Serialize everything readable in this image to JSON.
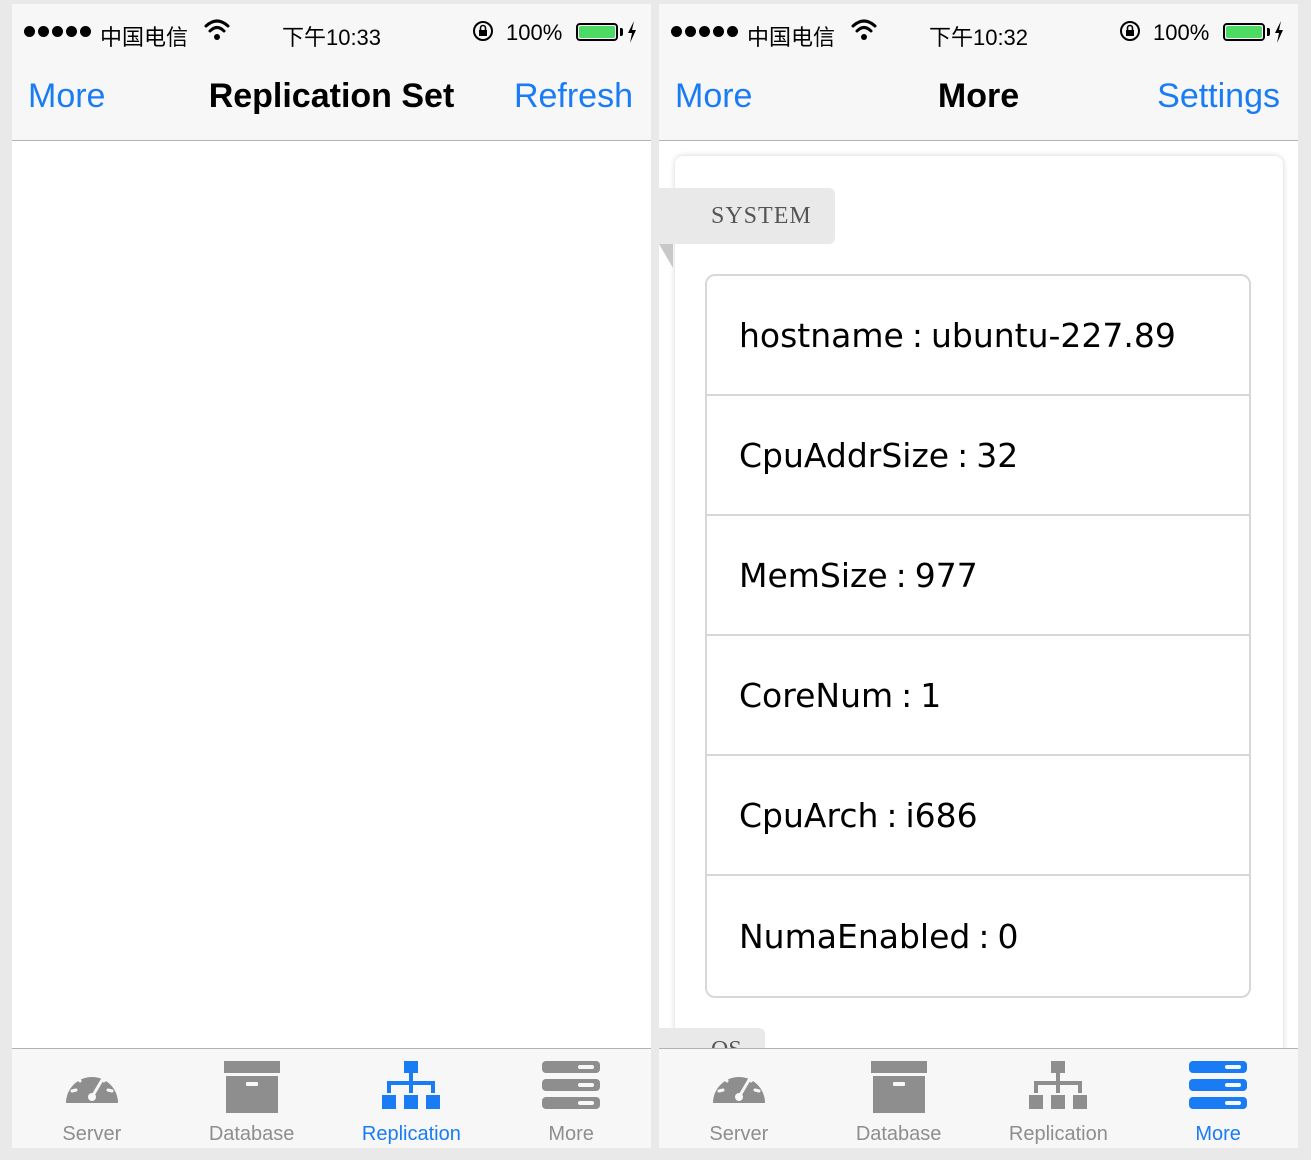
{
  "status_left": {
    "carrier": "中国电信",
    "time": "下午10:33",
    "battery": "100%"
  },
  "status_right": {
    "carrier": "中国电信",
    "time": "下午10:32",
    "battery": "100%"
  },
  "left_screen": {
    "nav": {
      "left": "More",
      "title": "Replication Set",
      "right": "Refresh"
    }
  },
  "right_screen": {
    "nav": {
      "left": "More",
      "title": "More",
      "right": "Settings"
    },
    "section_title": "SYSTEM",
    "next_section_partial": "OS",
    "rows": [
      {
        "key": "hostname",
        "value": "ubuntu-227.89"
      },
      {
        "key": "CpuAddrSize",
        "value": "32"
      },
      {
        "key": "MemSize",
        "value": "977"
      },
      {
        "key": "CoreNum",
        "value": "1"
      },
      {
        "key": "CpuArch",
        "value": "i686"
      },
      {
        "key": "NumaEnabled",
        "value": "0"
      }
    ]
  },
  "tabs": [
    {
      "label": "Server",
      "icon": "speedometer-icon"
    },
    {
      "label": "Database",
      "icon": "archive-box-icon"
    },
    {
      "label": "Replication",
      "icon": "hierarchy-icon"
    },
    {
      "label": "More",
      "icon": "stack-icon"
    }
  ],
  "left_active_tab": "Replication",
  "right_active_tab": "More",
  "colors": {
    "accent": "#1a7cf5",
    "inactive": "#8e8e8e",
    "battery": "#4cd964"
  }
}
